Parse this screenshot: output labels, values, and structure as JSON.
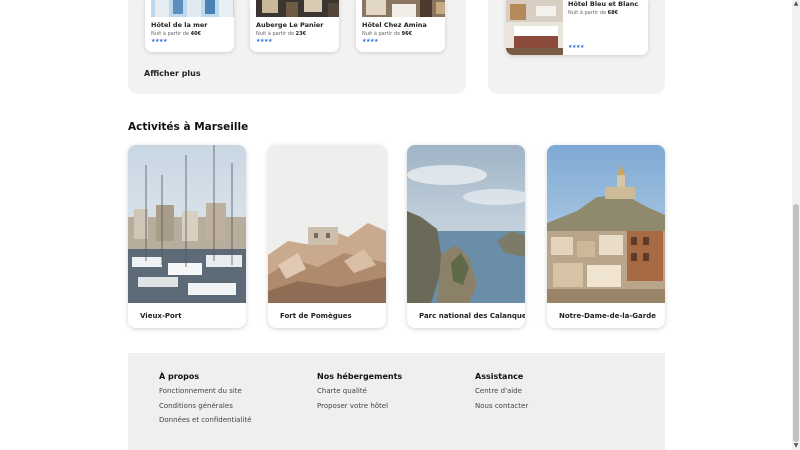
{
  "hotels": [
    {
      "name": "Hôtel de la mer",
      "price_prefix": "Nuit à partir de ",
      "price": "40€",
      "stars": "★★★★"
    },
    {
      "name": "Auberge Le Panier",
      "price_prefix": "Nuit à partir de ",
      "price": "23€",
      "stars": "★★★★"
    },
    {
      "name": "Hôtel Chez Amina",
      "price_prefix": "Nuit à partir de ",
      "price": "96€",
      "stars": "★★★★"
    }
  ],
  "afficher_plus": "Afficher plus",
  "featured_hotel": {
    "name": "Hôtel Bleu et Blanc",
    "price_prefix": "Nuit à partir de ",
    "price": "68€",
    "stars": "★★★★"
  },
  "activities": {
    "title": "Activités à Marseille",
    "items": [
      {
        "label": "Vieux-Port"
      },
      {
        "label": "Fort de Pomègues"
      },
      {
        "label": "Parc national des Calanques"
      },
      {
        "label": "Notre-Dame-de-la-Garde"
      }
    ]
  },
  "footer": {
    "columns": [
      {
        "heading": "À propos",
        "links": [
          "Fonctionnement du site",
          "Conditions générales",
          "Données et confidentialité"
        ]
      },
      {
        "heading": "Nos hébergements",
        "links": [
          "Charte qualité",
          "Proposer votre hôtel"
        ]
      },
      {
        "heading": "Assistance",
        "links": [
          "Centre d'aide",
          "Nous contacter"
        ]
      }
    ]
  },
  "colors": {
    "star": "#2a6fdb",
    "panel": "#f2f2f2",
    "footer": "#efefef"
  }
}
